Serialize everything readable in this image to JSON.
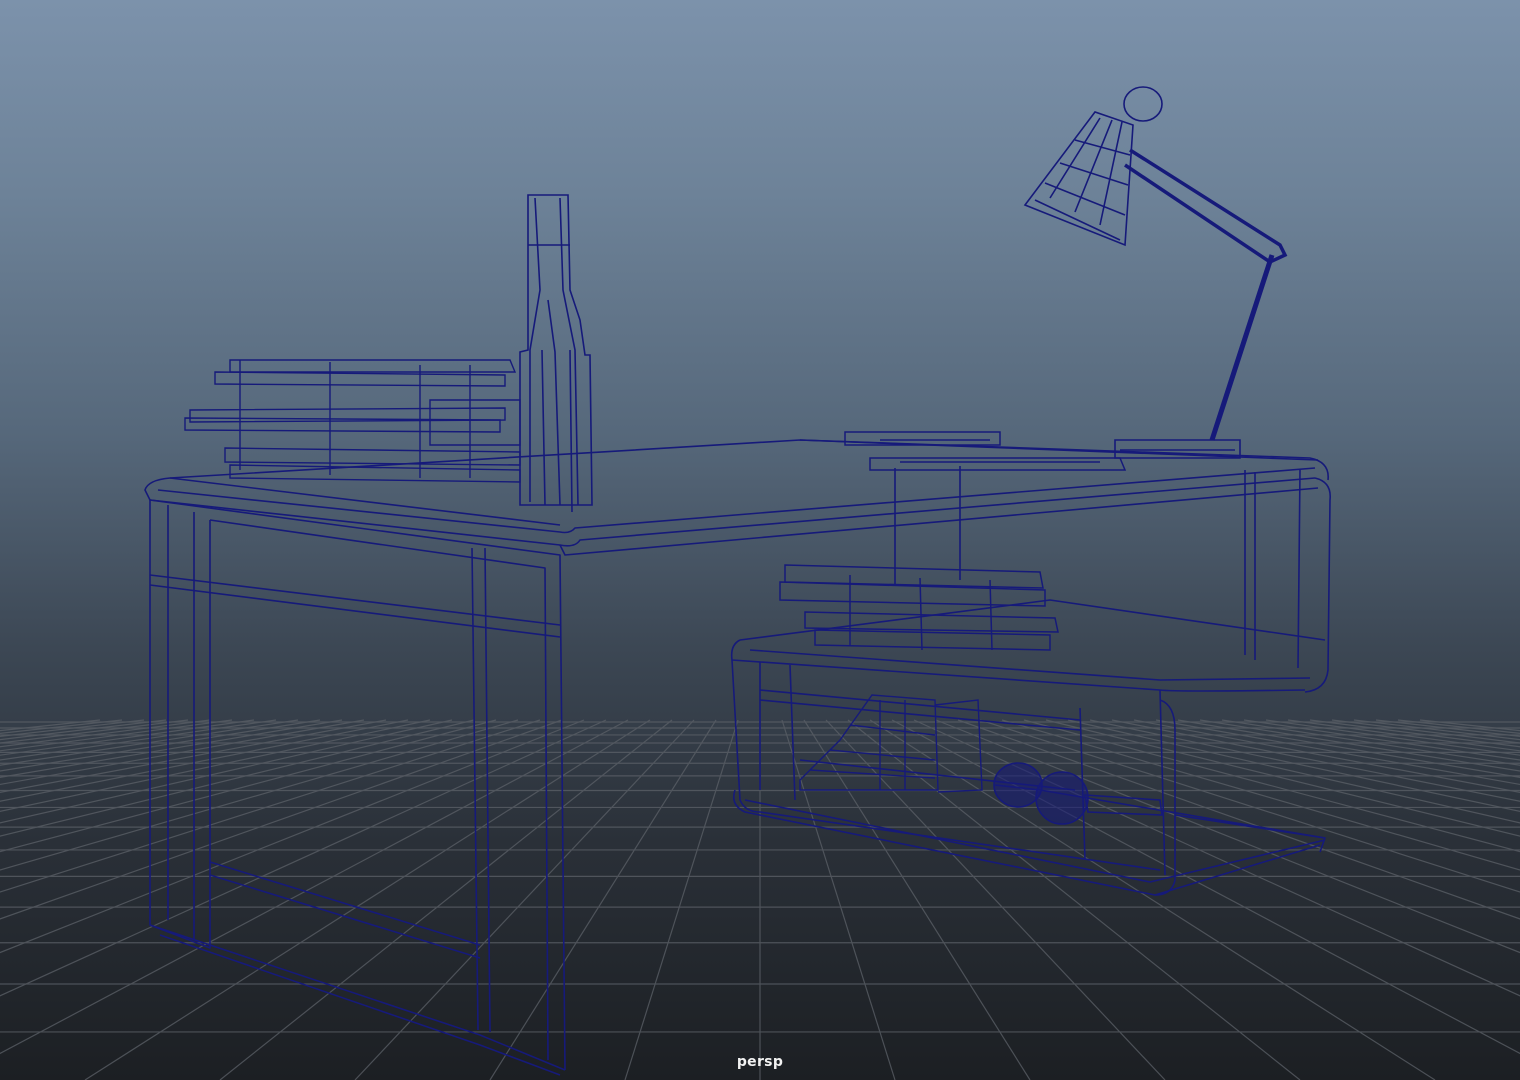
{
  "viewport": {
    "camera_name": "persp",
    "background_top_color": "#7c92ab",
    "background_bottom_color": "#1c1f23",
    "grid_color": "#5c6168",
    "wireframe_color": "#161a7a"
  },
  "scene": {
    "display_mode": "wireframe",
    "objects": [
      "desk",
      "desk-lamp",
      "bottles",
      "stacked-books",
      "shelf-books",
      "boots",
      "dumbbell",
      "tablet"
    ]
  }
}
